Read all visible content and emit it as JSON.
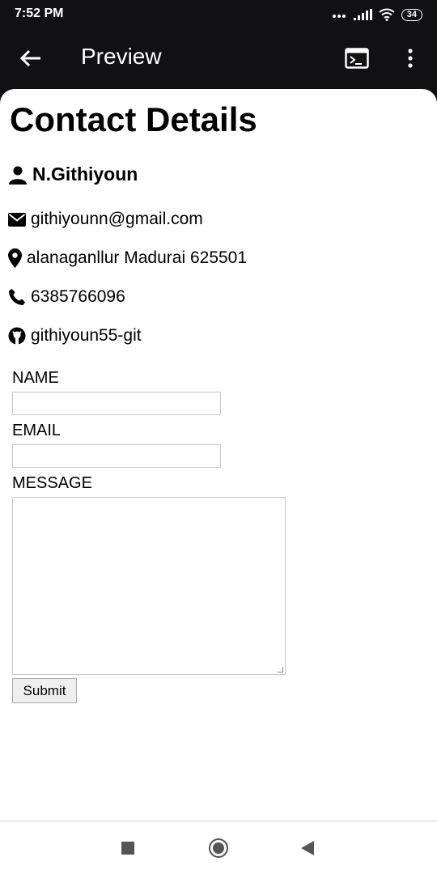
{
  "status_bar": {
    "time": "7:52 PM",
    "battery": "34"
  },
  "app_bar": {
    "title": "Preview"
  },
  "page": {
    "title": "Contact Details",
    "name": "N.Githiyoun",
    "email": "githiyounn@gmail.com",
    "address": "alanaganllur Madurai 625501",
    "phone": "6385766096",
    "github": "githiyoun55-git"
  },
  "form": {
    "name_label": "NAME",
    "email_label": "EMAIL",
    "message_label": "MESSAGE",
    "submit_label": "Submit"
  }
}
